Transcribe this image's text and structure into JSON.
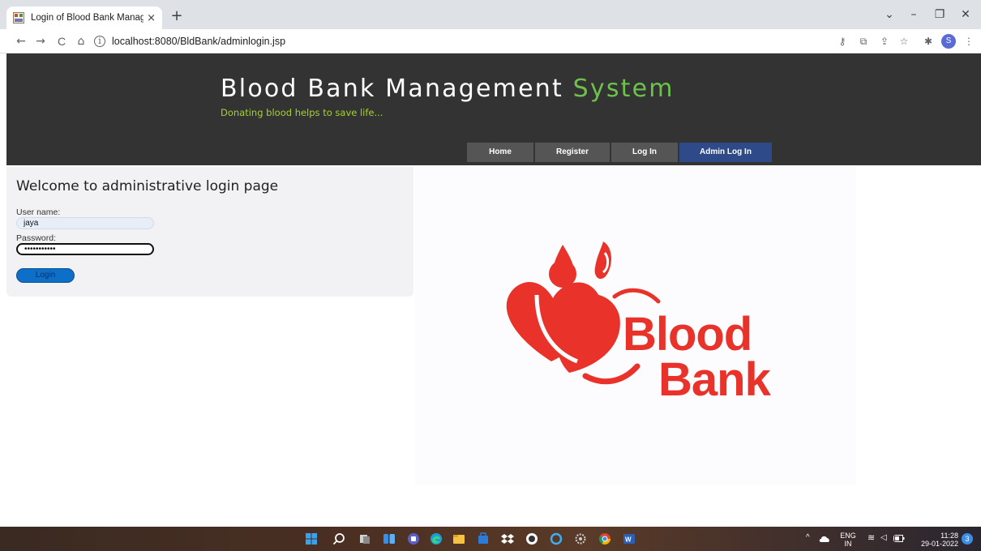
{
  "browser": {
    "tab_title": "Login of Blood Bank Manageme",
    "tab_close": "×",
    "new_tab": "+",
    "url": "localhost:8080/BldBank/adminlogin.jsp",
    "nav": {
      "back": "←",
      "forward": "→",
      "reload": "C",
      "home": "⌂"
    },
    "window": {
      "chevron": "⌄",
      "minimize": "–",
      "restore": "❐",
      "close": "✕"
    },
    "profile_initial": "S"
  },
  "site": {
    "title_main": "Blood Bank Management ",
    "title_accent": "System",
    "tagline": "Donating blood helps to save life...",
    "colors": {
      "header_bg": "#333333",
      "accent_green": "#6cc24a",
      "tagline_green": "#a4d233",
      "menu_active": "#2e4a88",
      "logo_red": "#e8322a"
    }
  },
  "nav_menu": {
    "home": "Home",
    "register": "Register",
    "login": "Log In",
    "admin": "Admin Log In",
    "active": "Admin Log In"
  },
  "login_form": {
    "heading": "Welcome to administrative login page",
    "username_label": "User name:",
    "username_value": "jaya",
    "password_label": "Password:",
    "password_value": "•••••••••••",
    "submit_label": "Login"
  },
  "logo": {
    "word1": "Blood",
    "word2": "Bank"
  },
  "taskbar": {
    "lang_line1": "ENG",
    "lang_line2": "IN",
    "time": "11:28",
    "date": "29-01-2022",
    "notification_count": "3",
    "tray_chevron": "^"
  }
}
